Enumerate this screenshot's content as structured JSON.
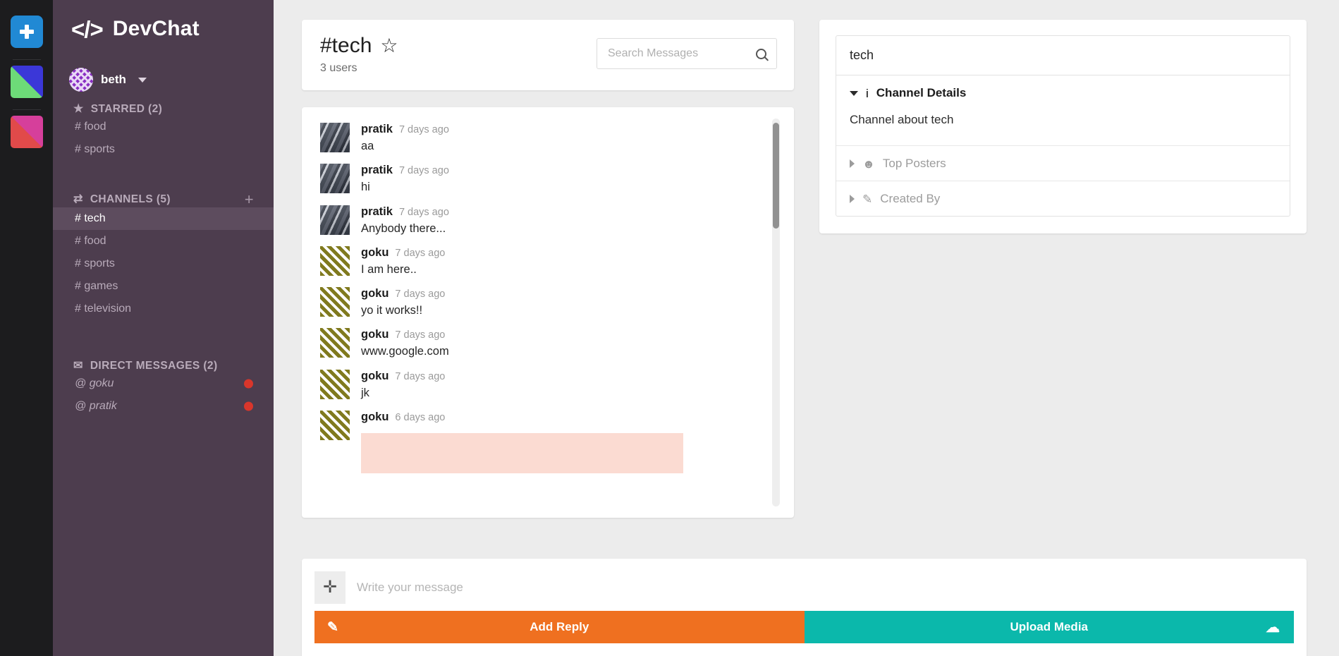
{
  "rail": {
    "add_workspace_label": "+",
    "workspaces": [
      {
        "name": "workspace-tile-1"
      },
      {
        "name": "workspace-tile-2"
      }
    ]
  },
  "sidebar": {
    "brand_logo": "</>",
    "brand_name": "DevChat",
    "user": {
      "name": "beth"
    },
    "starred": {
      "icon": "★",
      "label": "STARRED (2)",
      "items": [
        {
          "label": "# food"
        },
        {
          "label": "# sports"
        }
      ]
    },
    "channels": {
      "icon": "⇄",
      "label": "CHANNELS (5)",
      "add_label": "+",
      "items": [
        {
          "label": "# tech",
          "active": true
        },
        {
          "label": "# food",
          "active": false
        },
        {
          "label": "# sports",
          "active": false
        },
        {
          "label": "# games",
          "active": false
        },
        {
          "label": "# television",
          "active": false
        }
      ]
    },
    "direct_messages": {
      "icon": "✉",
      "label": "DIRECT MESSAGES (2)",
      "items": [
        {
          "label": "@ goku",
          "unread": true
        },
        {
          "label": "@ pratik",
          "unread": true
        }
      ]
    }
  },
  "chat": {
    "title": "#tech",
    "star_icon": "☆",
    "user_count": "3 users",
    "search_placeholder": "Search Messages",
    "search_value": "",
    "messages": [
      {
        "user": "pratik",
        "time": "7 days ago",
        "text": "aa",
        "avatar": "pratik"
      },
      {
        "user": "pratik",
        "time": "7 days ago",
        "text": "hi",
        "avatar": "pratik"
      },
      {
        "user": "pratik",
        "time": "7 days ago",
        "text": "Anybody there...",
        "avatar": "pratik"
      },
      {
        "user": "goku",
        "time": "7 days ago",
        "text": "I am here..",
        "avatar": "goku"
      },
      {
        "user": "goku",
        "time": "7 days ago",
        "text": "yo it works!!",
        "avatar": "goku"
      },
      {
        "user": "goku",
        "time": "7 days ago",
        "text": "www.google.com",
        "avatar": "goku"
      },
      {
        "user": "goku",
        "time": "7 days ago",
        "text": "jk",
        "avatar": "goku"
      },
      {
        "user": "goku",
        "time": "6 days ago",
        "text": "",
        "avatar": "goku",
        "media": true
      }
    ]
  },
  "details": {
    "search_value": "tech",
    "sections": [
      {
        "key": "channel_details",
        "icon": "i",
        "label": "Channel Details",
        "expanded": true,
        "body": "Channel about tech"
      },
      {
        "key": "top_posters",
        "icon": "☻",
        "label": "Top Posters",
        "expanded": false
      },
      {
        "key": "created_by",
        "icon": "✎",
        "label": "Created By",
        "expanded": false
      }
    ]
  },
  "composer": {
    "attach_label": "✛",
    "placeholder": "Write your message",
    "value": "",
    "add_reply_label": "Add Reply",
    "add_reply_icon": "✎",
    "upload_label": "Upload Media",
    "upload_icon": "☁"
  },
  "colors": {
    "sidebar_bg": "#4d3d4e",
    "rail_bg": "#1c1c1e",
    "accent_orange": "#ef7020",
    "accent_teal": "#0bb8ab",
    "unread_dot": "#d9362b",
    "media_placeholder": "#fbdbd2"
  }
}
